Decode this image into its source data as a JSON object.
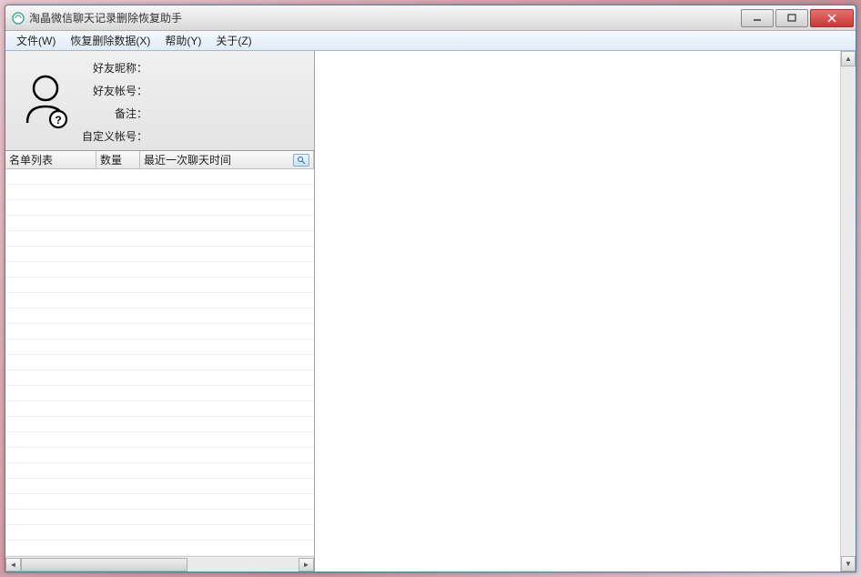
{
  "window": {
    "title": "淘晶微信聊天记录删除恢复助手"
  },
  "menu": {
    "file": "文件(W)",
    "recover": "恢复删除数据(X)",
    "help": "帮助(Y)",
    "about": "关于(Z)"
  },
  "info": {
    "nickname_label": "好友昵称：",
    "nickname_value": "",
    "account_label": "好友帐号：",
    "account_value": "",
    "remark_label": "备注：",
    "remark_value": "",
    "custom_account_label": "自定义帐号：",
    "custom_account_value": ""
  },
  "table": {
    "columns": {
      "name_list": "名单列表",
      "count": "数量",
      "last_chat": "最近一次聊天时间"
    },
    "rows": []
  }
}
